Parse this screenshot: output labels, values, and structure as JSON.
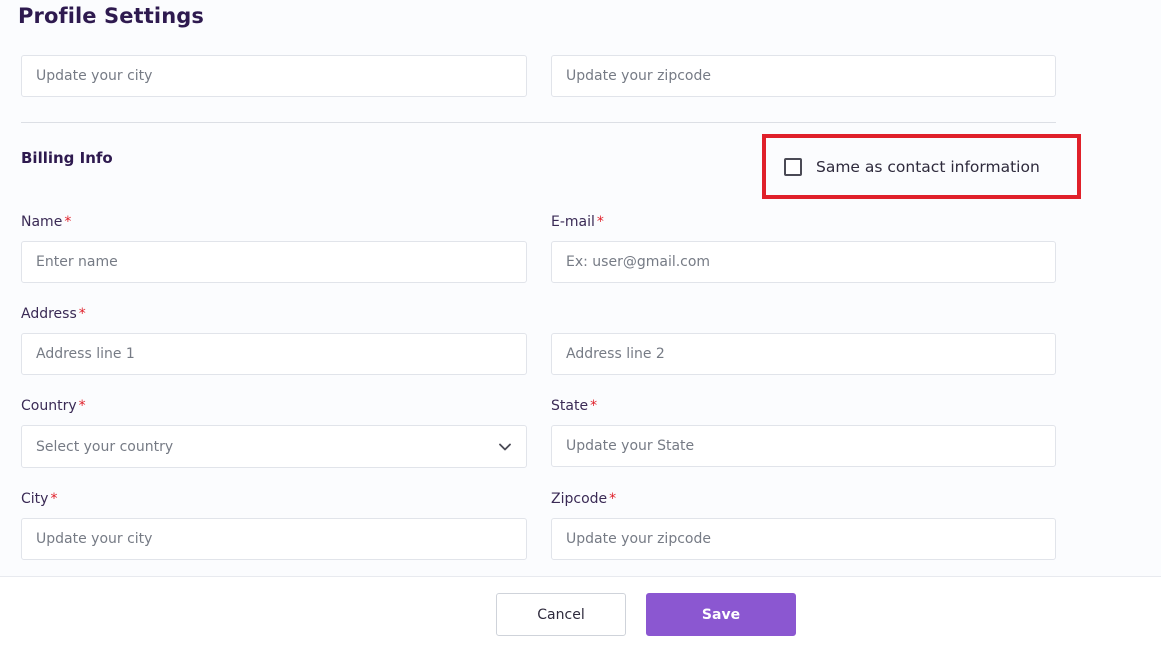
{
  "page": {
    "title": "Profile Settings"
  },
  "contact_top": {
    "city_placeholder": "Update your city",
    "zipcode_placeholder": "Update your zipcode"
  },
  "billing": {
    "title": "Billing Info",
    "same_as_contact": {
      "label": "Same as contact information",
      "checked": false
    },
    "name": {
      "label": "Name",
      "required": "*",
      "placeholder": "Enter name"
    },
    "email": {
      "label": "E-mail",
      "required": "*",
      "placeholder": "Ex: user@gmail.com"
    },
    "address": {
      "label": "Address",
      "required": "*",
      "line1_placeholder": "Address line 1",
      "line2_placeholder": "Address line 2"
    },
    "country": {
      "label": "Country",
      "required": "*",
      "placeholder": "Select your country"
    },
    "state": {
      "label": "State",
      "required": "*",
      "placeholder": "Update your State"
    },
    "city": {
      "label": "City",
      "required": "*",
      "placeholder": "Update your city"
    },
    "zipcode": {
      "label": "Zipcode",
      "required": "*",
      "placeholder": "Update your zipcode"
    }
  },
  "footer": {
    "cancel_label": "Cancel",
    "save_label": "Save"
  },
  "colors": {
    "accent": "#8b57d1",
    "required": "#e0202a",
    "highlight": "#e0202a"
  },
  "icons": {
    "checkbox": "checkbox-icon",
    "dropdown": "chevron-down-icon"
  }
}
